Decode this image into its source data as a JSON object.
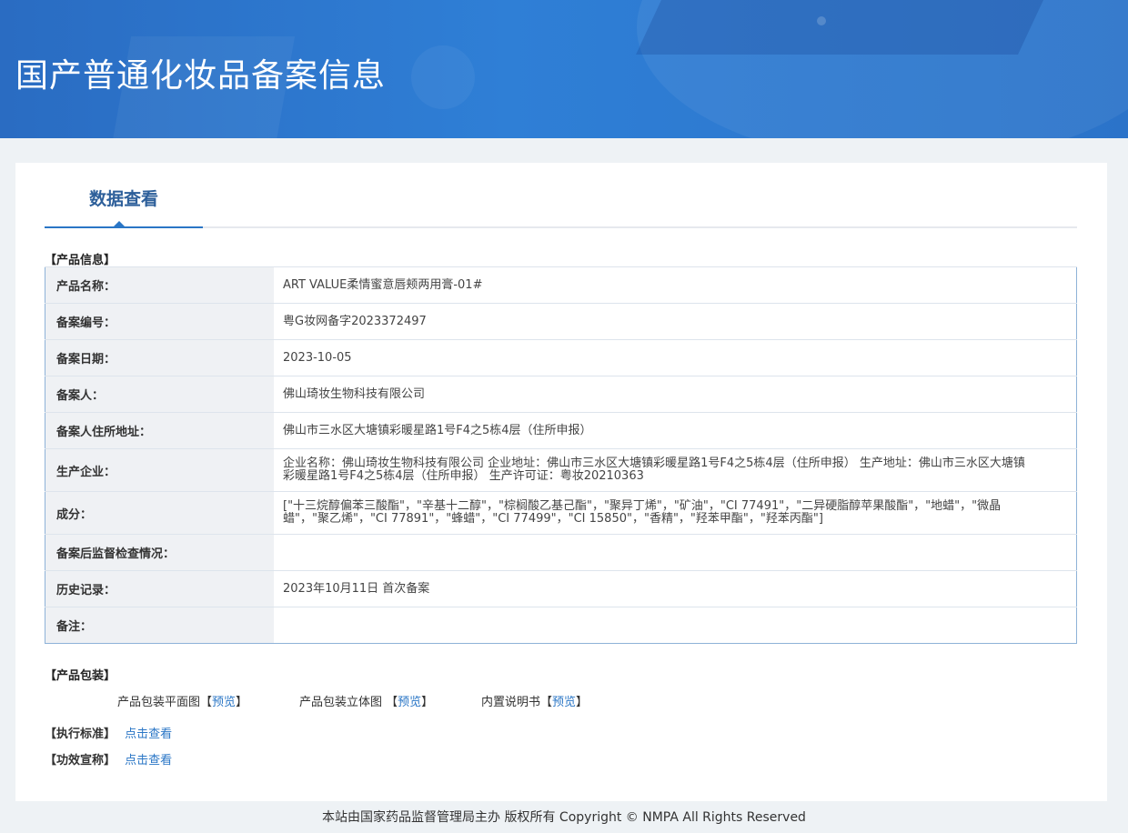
{
  "banner": {
    "title": "国产普通化妆品备案信息"
  },
  "tab": {
    "label": "数据查看"
  },
  "product_info": {
    "section_title": "【产品信息】",
    "rows": [
      {
        "key": "产品名称：",
        "value": "ART VALUE柔情蜜意唇颊两用膏-01#"
      },
      {
        "key": "备案编号：",
        "value": "粤G妆网备字2023372497"
      },
      {
        "key": "备案日期：",
        "value": "2023-10-05"
      },
      {
        "key": "备案人：",
        "value": "佛山琦妆生物科技有限公司"
      },
      {
        "key": "备案人住所地址：",
        "value": "佛山市三水区大塘镇彩暖星路1号F4之5栋4层（住所申报）"
      },
      {
        "key": "生产企业：",
        "value": "企业名称：佛山琦妆生物科技有限公司 企业地址：佛山市三水区大塘镇彩暖星路1号F4之5栋4层（住所申报） 生产地址：佛山市三水区大塘镇彩暖星路1号F4之5栋4层（住所申报） 生产许可证：粤妆20210363"
      },
      {
        "key": "成分：",
        "value": "[\"十三烷醇偏苯三酸酯\"，\"辛基十二醇\"，\"棕榈酸乙基己酯\"，\"聚异丁烯\"，\"矿油\"，\"CI 77491\"，\"二异硬脂醇苹果酸酯\"，\"地蜡\"，\"微晶蜡\"，\"聚乙烯\"，\"CI 77891\"，\"蜂蜡\"，\"CI 77499\"，\"CI 15850\"，\"香精\"，\"羟苯甲酯\"，\"羟苯丙酯\"]"
      },
      {
        "key": "备案后监督检查情况：",
        "value": ""
      },
      {
        "key": "历史记录：",
        "value": "2023年10月11日 首次备案"
      },
      {
        "key": "备注：",
        "value": ""
      }
    ]
  },
  "packaging": {
    "section_title": "【产品包装】",
    "items": [
      {
        "label": "产品包装平面图【",
        "link": "预览",
        "suffix": "】"
      },
      {
        "label": "产品包装立体图 【",
        "link": "预览",
        "suffix": "】"
      },
      {
        "label": "内置说明书【",
        "link": "预览",
        "suffix": "】"
      }
    ]
  },
  "standard": {
    "label": "【执行标准】",
    "link": "点击查看"
  },
  "efficacy": {
    "label": "【功效宣称】",
    "link": "点击查看"
  },
  "footer": {
    "text": "本站由国家药品监督管理局主办 版权所有 Copyright © NMPA All Rights Reserved"
  }
}
